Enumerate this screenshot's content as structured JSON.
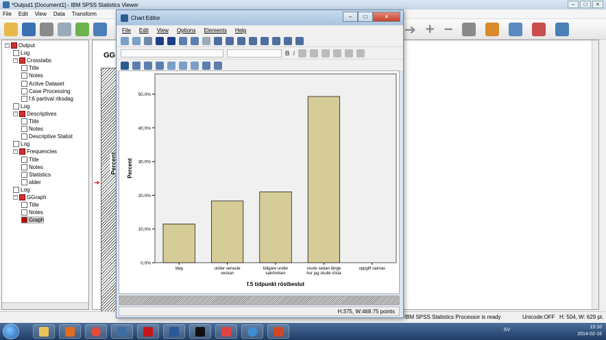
{
  "viewer": {
    "title": "*Output1 [Document1] - IBM SPSS Statistics Viewer",
    "menu": [
      "File",
      "Edit",
      "View",
      "Data",
      "Transform"
    ],
    "content_heading": "GG",
    "hatch_label": "Percent",
    "status": {
      "processor": "IBM SPSS Statistics Processor is ready",
      "unicode": "Unicode:OFF",
      "size": "H: 504, W: 629 pt."
    }
  },
  "outline": {
    "items": [
      {
        "label": "Output",
        "level": 0,
        "kind": "book"
      },
      {
        "label": "Log",
        "level": 1,
        "kind": "page"
      },
      {
        "label": "Crosstabs",
        "level": 1,
        "kind": "book"
      },
      {
        "label": "Title",
        "level": 2,
        "kind": "page"
      },
      {
        "label": "Notes",
        "level": 2,
        "kind": "page"
      },
      {
        "label": "Active Dataset",
        "level": 2,
        "kind": "page"
      },
      {
        "label": "Case Processing",
        "level": 2,
        "kind": "page"
      },
      {
        "label": "f.6 partival riksdag",
        "level": 2,
        "kind": "page"
      },
      {
        "label": "Log",
        "level": 1,
        "kind": "page"
      },
      {
        "label": "Descriptives",
        "level": 1,
        "kind": "book"
      },
      {
        "label": "Title",
        "level": 2,
        "kind": "page"
      },
      {
        "label": "Notes",
        "level": 2,
        "kind": "page"
      },
      {
        "label": "Descriptive Statist",
        "level": 2,
        "kind": "page"
      },
      {
        "label": "Log",
        "level": 1,
        "kind": "page"
      },
      {
        "label": "Frequencies",
        "level": 1,
        "kind": "book"
      },
      {
        "label": "Title",
        "level": 2,
        "kind": "page"
      },
      {
        "label": "Notes",
        "level": 2,
        "kind": "page"
      },
      {
        "label": "Statistics",
        "level": 2,
        "kind": "page"
      },
      {
        "label": "alder",
        "level": 2,
        "kind": "page"
      },
      {
        "label": "Log",
        "level": 1,
        "kind": "page"
      },
      {
        "label": "GGraph",
        "level": 1,
        "kind": "book"
      },
      {
        "label": "Title",
        "level": 2,
        "kind": "page"
      },
      {
        "label": "Notes",
        "level": 2,
        "kind": "page"
      },
      {
        "label": "Graph",
        "level": 2,
        "kind": "graph",
        "active": true
      }
    ]
  },
  "editor": {
    "title": "Chart Editor",
    "menu": [
      "File",
      "Edit",
      "View",
      "Options",
      "Elements",
      "Help"
    ],
    "status": "H:375, W:468.75 points"
  },
  "colors": {
    "bar_fill": "#d5cc98",
    "bar_stroke": "#000000",
    "plot_bg": "#f0f0f0"
  },
  "chart_data": {
    "type": "bar",
    "categories": [
      "idag",
      "under senaste veckan",
      "tidigare under valrörelsen",
      "visste sedan länge hur jag skulle rösta",
      "uppgift saknas"
    ],
    "category_lines": [
      [
        "idag"
      ],
      [
        "under senaste",
        "veckan"
      ],
      [
        "tidigare under",
        "valrörelsen"
      ],
      [
        "visste sedan länge",
        "hur jag skulle rösta"
      ],
      [
        "uppgift saknas"
      ]
    ],
    "values": [
      11.5,
      18.3,
      21.0,
      49.3,
      0
    ],
    "xlabel": "f.5 tidpunkt röstbeslut",
    "ylabel": "Percent",
    "ylim": [
      0,
      56
    ],
    "yticks": [
      0,
      10,
      20,
      30,
      40,
      50
    ],
    "ytick_labels": [
      "0,0%",
      "10,0%",
      "20,0%",
      "30,0%",
      "40,0%",
      "50,0%"
    ],
    "grid": false
  },
  "taskbar": {
    "lang": "SV",
    "time": "15:10",
    "date": "2014-02-16"
  }
}
